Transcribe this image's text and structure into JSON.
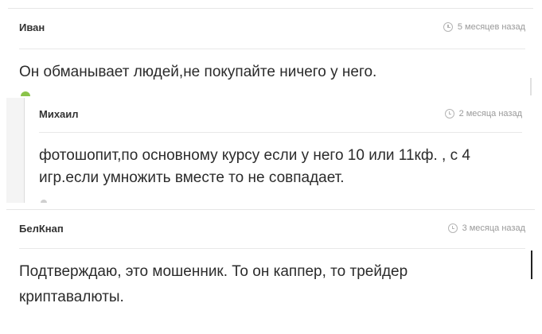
{
  "comments": [
    {
      "author": "Иван",
      "time": "5 месяцев назад",
      "text": "Он обманывает людей,не покупайте ничего у него."
    },
    {
      "author": "Михаил",
      "time": "2 месяца назад",
      "text_line1": "фотошопит,по основному курсу если у него 10 или 11кф. , с 4",
      "text_line2": "игр.если умножить вместе то не совпадает."
    },
    {
      "author": "БелКнап",
      "time": "3 месяца назад",
      "text_line1": "Подтверждаю, это мошенник. То он каппер, то трейдер",
      "text_line2": "криптавалюты."
    }
  ],
  "icons": {
    "time": "clock-icon"
  },
  "colors": {
    "accent_green": "#8bc34a",
    "meta_gray": "#9a9a9a"
  }
}
